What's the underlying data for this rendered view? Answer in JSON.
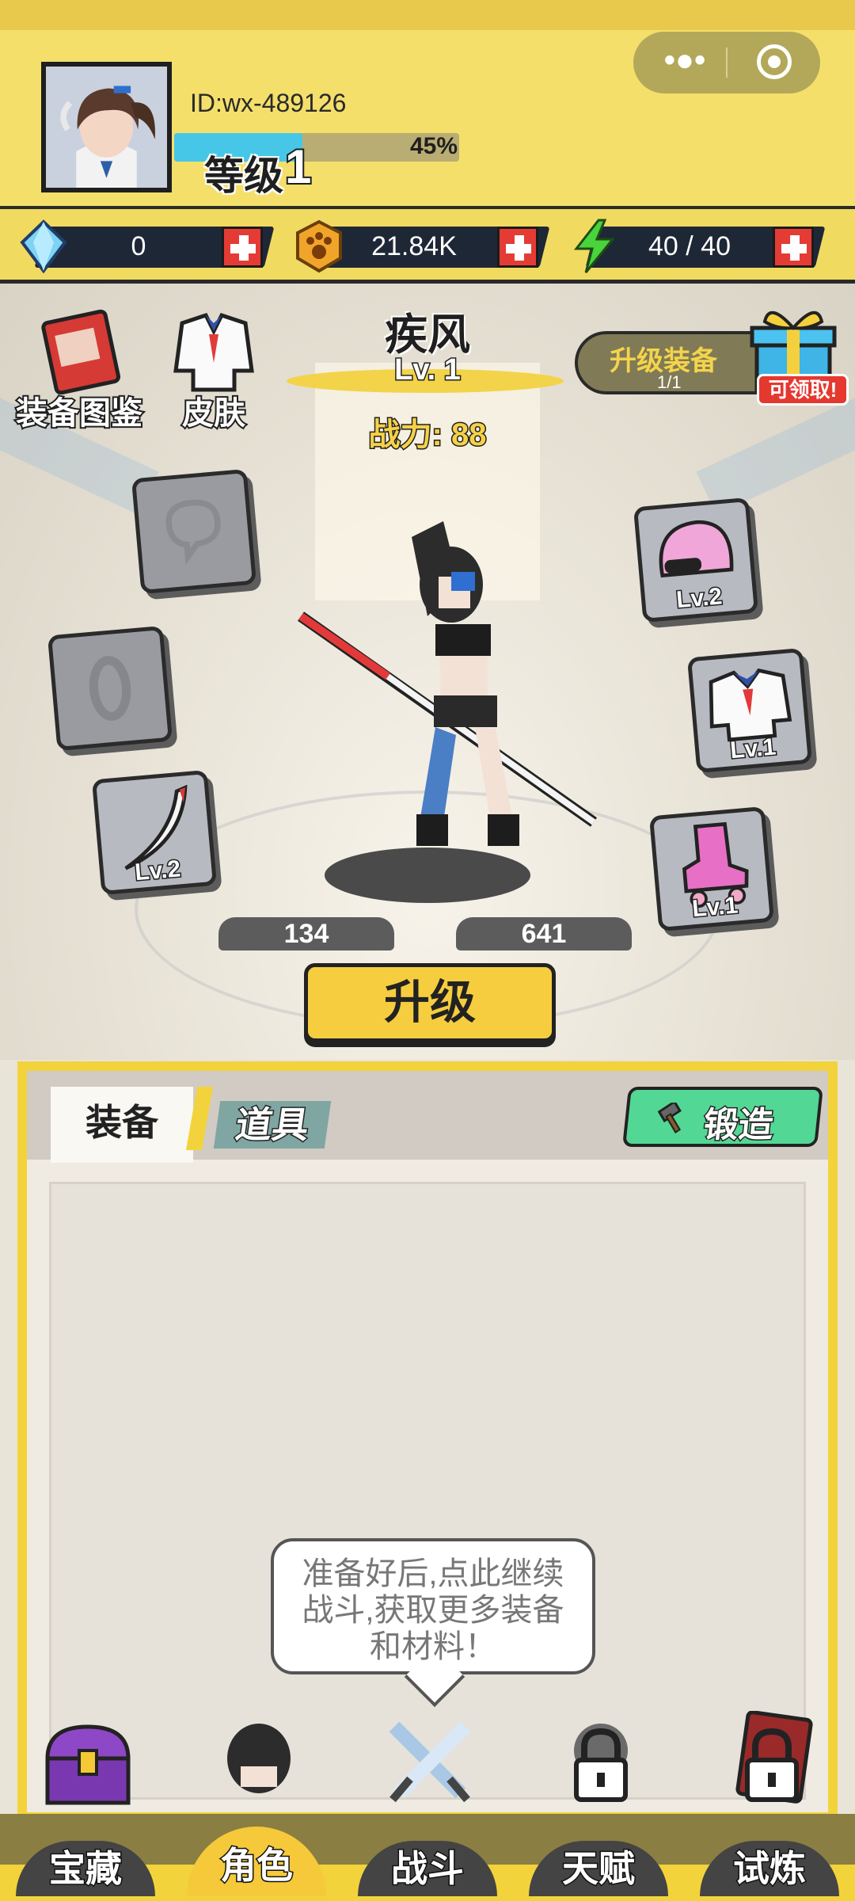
{
  "player": {
    "id_text": "ID:wx-489126",
    "level_label": "等级",
    "level": "1",
    "xp_percent": "45%",
    "xp_fraction": 0.45
  },
  "resources": [
    {
      "name": "diamond",
      "icon": "diamond-icon",
      "value": "0"
    },
    {
      "name": "gold",
      "icon": "paw-coin-icon",
      "value": "21.84K"
    },
    {
      "name": "energy",
      "icon": "lightning-icon",
      "value": "40 / 40"
    }
  ],
  "hero": {
    "name": "疾风",
    "level": "Lv. 1",
    "power": "战力: 88",
    "stat_left": "134",
    "stat_right": "641"
  },
  "side_buttons": {
    "codex": "装备图鉴",
    "skin": "皮肤"
  },
  "upgrade_tag": {
    "title": "升级装备",
    "progress": "1/1",
    "claim": "可领取!"
  },
  "slots": {
    "weapon_level": "Lv.2",
    "helmet_level": "Lv.2",
    "armor_level": "Lv.1",
    "boots_level": "Lv.1"
  },
  "upgrade_button": "升级",
  "bag": {
    "tab_equipment": "装备",
    "tab_items": "道具",
    "forge": "锻造"
  },
  "bubble": {
    "line1": "准备好后,点此继续",
    "line2": "战斗,获取更多装备",
    "line3": "和材料！"
  },
  "nav": [
    {
      "label": "宝藏",
      "icon": "treasure-chest-icon",
      "active": false,
      "locked": false
    },
    {
      "label": "角色",
      "icon": "character-icon",
      "active": true,
      "locked": false
    },
    {
      "label": "战斗",
      "icon": "crossed-swords-icon",
      "active": false,
      "locked": false
    },
    {
      "label": "天赋",
      "icon": "lock-icon",
      "active": false,
      "locked": true
    },
    {
      "label": "试炼",
      "icon": "lock-icon",
      "active": false,
      "locked": true
    }
  ],
  "colors": {
    "header_yellow": "#f4df6b",
    "xp_blue": "#46c7e8",
    "accent_yellow": "#f6cd3e",
    "forge_green": "#52d894",
    "claim_red": "#e5382f"
  }
}
